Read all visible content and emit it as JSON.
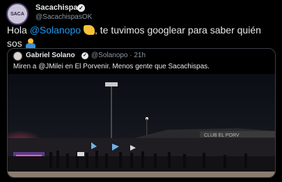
{
  "tweet": {
    "author_name": "Sacachispas",
    "author_handle": "@SacachispasOK",
    "verified_mark": "✓",
    "avatar_label": "SACA",
    "text_before": "Hola ",
    "mention": "@Solanopo",
    "text_after": ", te tuvimos googlear para saber quién sos",
    "emoji_1": "waving-hand",
    "emoji_2": "person-facepalming"
  },
  "quoted": {
    "author_name": "Gabriel Solano",
    "author_handle": "@Solanopo",
    "time": "21h",
    "separator": "·",
    "text": "Miren a @JMilei en El Porvenir. Menos gente que Sacachispas.",
    "media_alt": "crowd-at-night-stadium-photo",
    "stadium_sign": "CLUB EL PORV"
  },
  "colors": {
    "background": "#000000",
    "text": "#e7e9ea",
    "secondary": "#8b98a5",
    "link": "#1d9bf0",
    "border": "#3b4148"
  }
}
